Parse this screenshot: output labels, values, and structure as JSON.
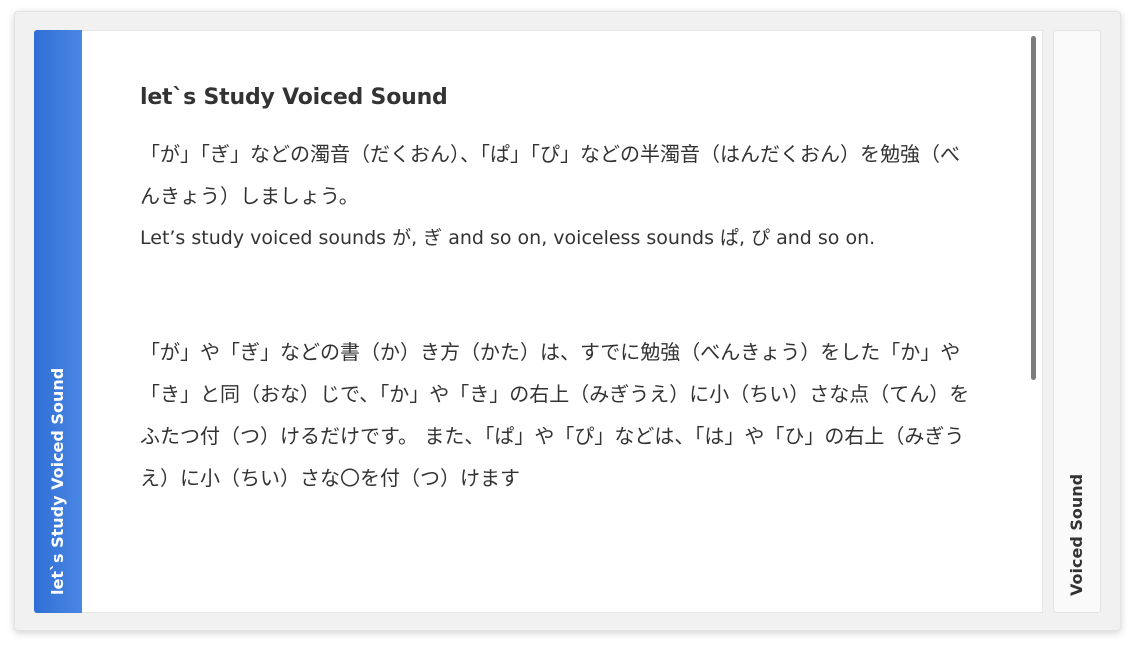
{
  "accordion": {
    "tabs": [
      {
        "label": "let`s Study Voiced Sound",
        "state": "active"
      },
      {
        "label": "Voiced Sound",
        "state": "collapsed"
      }
    ],
    "accent_color": "#3a7bdc"
  },
  "panel": {
    "title": "let`s Study Voiced Sound",
    "paragraph_ja": "「が」「ぎ」などの濁音（だくおん）、「ぱ」「ぴ」などの半濁音（はんだくおん）を勉強（べんきょう）しましょう。",
    "paragraph_en": " Let’s study voiced sounds が, ぎ and so on, voiceless sounds ぱ, ぴ and so on.",
    "paragraph2": "「が」や「ぎ」などの書（か）き方（かた）は、すでに勉強（べんきょう）をした「か」や「き」と同（おな）じで、「か」や「き」の右上（みぎうえ）に小（ちい）さな点（てん）をふたつ付（つ）けるだけです。 また、「ぱ」や「ぴ」などは、「は」や「ひ」の右上（みぎうえ）に小（ちい）さな〇を付（つ）けます"
  }
}
